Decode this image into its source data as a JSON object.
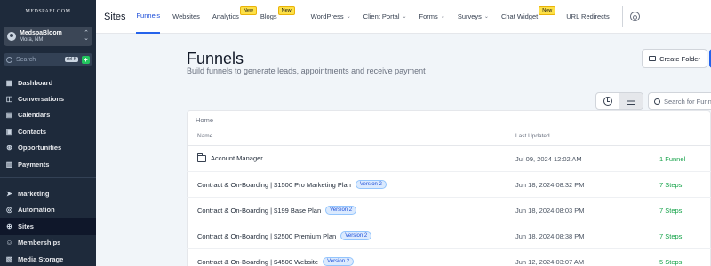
{
  "sidebar": {
    "logo": "MEDSPABLOOM",
    "account": {
      "name": "MedspaBloom",
      "location": "Mora, NM"
    },
    "search": {
      "placeholder": "Search",
      "shortcut": "ctrl K"
    },
    "items": [
      {
        "label": "Dashboard",
        "icon": "dashboard-icon"
      },
      {
        "label": "Conversations",
        "icon": "chat-icon"
      },
      {
        "label": "Calendars",
        "icon": "calendar-icon"
      },
      {
        "label": "Contacts",
        "icon": "contacts-icon"
      },
      {
        "label": "Opportunities",
        "icon": "opportunities-icon"
      },
      {
        "label": "Payments",
        "icon": "payments-icon"
      }
    ],
    "items2": [
      {
        "label": "Marketing",
        "icon": "marketing-icon"
      },
      {
        "label": "Automation",
        "icon": "automation-icon"
      },
      {
        "label": "Sites",
        "icon": "sites-icon",
        "active": true
      },
      {
        "label": "Memberships",
        "icon": "memberships-icon"
      },
      {
        "label": "Media Storage",
        "icon": "media-icon"
      }
    ]
  },
  "topbar": {
    "title": "Sites",
    "tabs": [
      {
        "label": "Funnels",
        "active": true
      },
      {
        "label": "Websites"
      },
      {
        "label": "Analytics",
        "badge": "New"
      },
      {
        "label": "Blogs",
        "badge": "New"
      },
      {
        "label": "WordPress",
        "dropdown": true
      },
      {
        "label": "Client Portal",
        "dropdown": true
      },
      {
        "label": "Forms",
        "dropdown": true
      },
      {
        "label": "Surveys",
        "dropdown": true
      },
      {
        "label": "Chat Widget",
        "badge": "New"
      },
      {
        "label": "URL Redirects"
      }
    ]
  },
  "main": {
    "title": "Funnels",
    "subtitle": "Build funnels to generate leads, appointments and receive payment",
    "create_folder": "Create Folder",
    "search_placeholder": "Search for Funnels",
    "breadcrumb": "Home",
    "columns": {
      "name": "Name",
      "updated": "Last Updated"
    },
    "rows": [
      {
        "name": "Account Manager",
        "type": "folder",
        "updated": "Jul 09, 2024 12:02 AM",
        "steps": "1 Funnel"
      },
      {
        "name": "Contract & On-Boarding | $1500 Pro Marketing Plan",
        "version": "Version 2",
        "updated": "Jun 18, 2024 08:32 PM",
        "steps": "7 Steps"
      },
      {
        "name": "Contract & On-Boarding | $199 Base Plan",
        "version": "Version 2",
        "updated": "Jun 18, 2024 08:03 PM",
        "steps": "7 Steps"
      },
      {
        "name": "Contract & On-Boarding | $2500 Premium Plan",
        "version": "Version 2",
        "updated": "Jun 18, 2024 08:38 PM",
        "steps": "7 Steps"
      },
      {
        "name": "Contract & On-Boarding | $4500 Website",
        "version": "Version 2",
        "updated": "Jun 12, 2024 03:07 AM",
        "steps": "5 Steps"
      }
    ]
  },
  "colors": {
    "sidebar_bg": "#1e2a3b",
    "accent": "#2563eb",
    "steps_green": "#16a34a",
    "badge_yellow": "#fde047"
  }
}
